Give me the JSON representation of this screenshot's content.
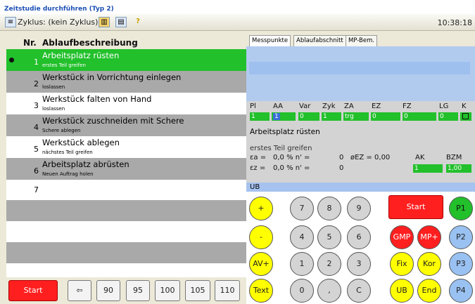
{
  "window": {
    "title": "Zeitstudie durchführen (Typ 2)"
  },
  "toolbar": {
    "cycle_label": "Zyklus: (kein Zyklus)",
    "time": "10:38:18"
  },
  "list": {
    "header_nr": "Nr.",
    "header_desc": "Ablaufbeschreibung",
    "rows": [
      {
        "num": "1",
        "title": "Arbeitsplatz rüsten",
        "sub": "erstes Teil greifen"
      },
      {
        "num": "2",
        "title": "Werkstück in Vorrichtung einlegen",
        "sub": "loslassen"
      },
      {
        "num": "3",
        "title": "Werkstück falten von Hand",
        "sub": "loslassen"
      },
      {
        "num": "4",
        "title": "Werkstück zuschneiden mit Schere",
        "sub": "Schere ablegen"
      },
      {
        "num": "5",
        "title": "Werkstück ablegen",
        "sub": "nächstes Teil greifen"
      },
      {
        "num": "6",
        "title": "Arbeitsplatz abrüsten",
        "sub": "Neuen Auftrag holen"
      },
      {
        "num": "7",
        "title": "",
        "sub": ""
      }
    ]
  },
  "bottom": {
    "start": "Start",
    "back": "⇦",
    "values": [
      "90",
      "95",
      "100",
      "105",
      "110"
    ]
  },
  "tabs": [
    "Messpunkte",
    "Ablaufabschnitt",
    "MP-Bem."
  ],
  "fields": {
    "labels": [
      "Pl",
      "AA",
      "Var",
      "Zyk",
      "ZA",
      "EZ",
      "FZ",
      "LG",
      "K"
    ],
    "values": [
      "1",
      "1",
      "0",
      "1",
      "trg",
      "0",
      "0",
      "0",
      ""
    ],
    "operation": "Arbeitsplatz rüsten",
    "sub": "erstes Teil greifen",
    "ea_line": "0,0 %  n' =",
    "ea_val": "0",
    "ez_line": "0,0 %  n' =",
    "ez_val": "0",
    "oez": "øEZ = 0,00",
    "ak_label": "AK",
    "ak_val": "1",
    "bzm_label": "BZM",
    "bzm_val": "1,00",
    "ea_sym": "εa =",
    "ez_sym": "εz ="
  },
  "ub": "UB",
  "keypad": {
    "left": [
      "+",
      "-",
      "AV+",
      "Text"
    ],
    "digits": [
      "7",
      "8",
      "9",
      "4",
      "5",
      "6",
      "1",
      "2",
      "3",
      "0",
      ",",
      "C"
    ],
    "start": "Start",
    "p": [
      "P1",
      "P2",
      "P3",
      "P4"
    ],
    "gmp": "GMP",
    "mpplus": "MP+",
    "fix": "Fix",
    "kor": "Kor",
    "ub": "UB",
    "end": "End"
  }
}
